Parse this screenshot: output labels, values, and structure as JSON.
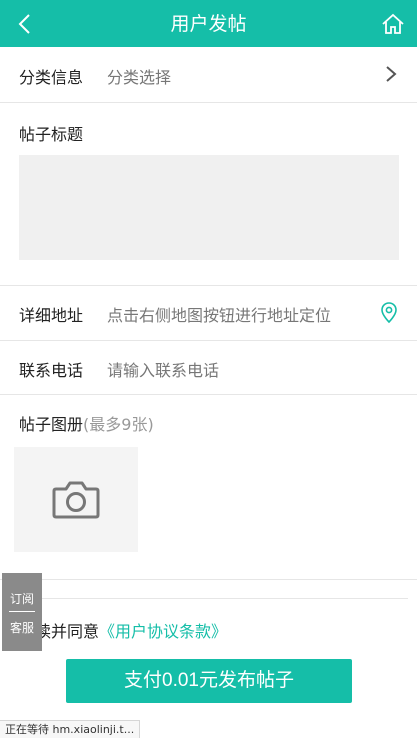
{
  "header": {
    "title": "用户发帖",
    "back_icon": "chevron-left-icon",
    "home_icon": "home-icon",
    "bg_color": "#15bea8"
  },
  "form": {
    "category": {
      "label": "分类信息",
      "value": "分类选择"
    },
    "title": {
      "label": "帖子标题",
      "value": ""
    },
    "address": {
      "label": "详细地址",
      "placeholder": "点击右侧地图按钮进行地址定位"
    },
    "phone": {
      "label": "联系电话",
      "placeholder": "请输入联系电话"
    },
    "gallery": {
      "label": "帖子图册",
      "hint": "(最多9张)"
    }
  },
  "agreement": {
    "prefix": "阅读并同意",
    "link": "《用户协议条款》"
  },
  "submit_label": "支付0.01元发布帖子",
  "side_float": {
    "subscribe": "订阅",
    "service": "客服"
  },
  "status_text": "正在等待 hm.xiaolinji.t..."
}
